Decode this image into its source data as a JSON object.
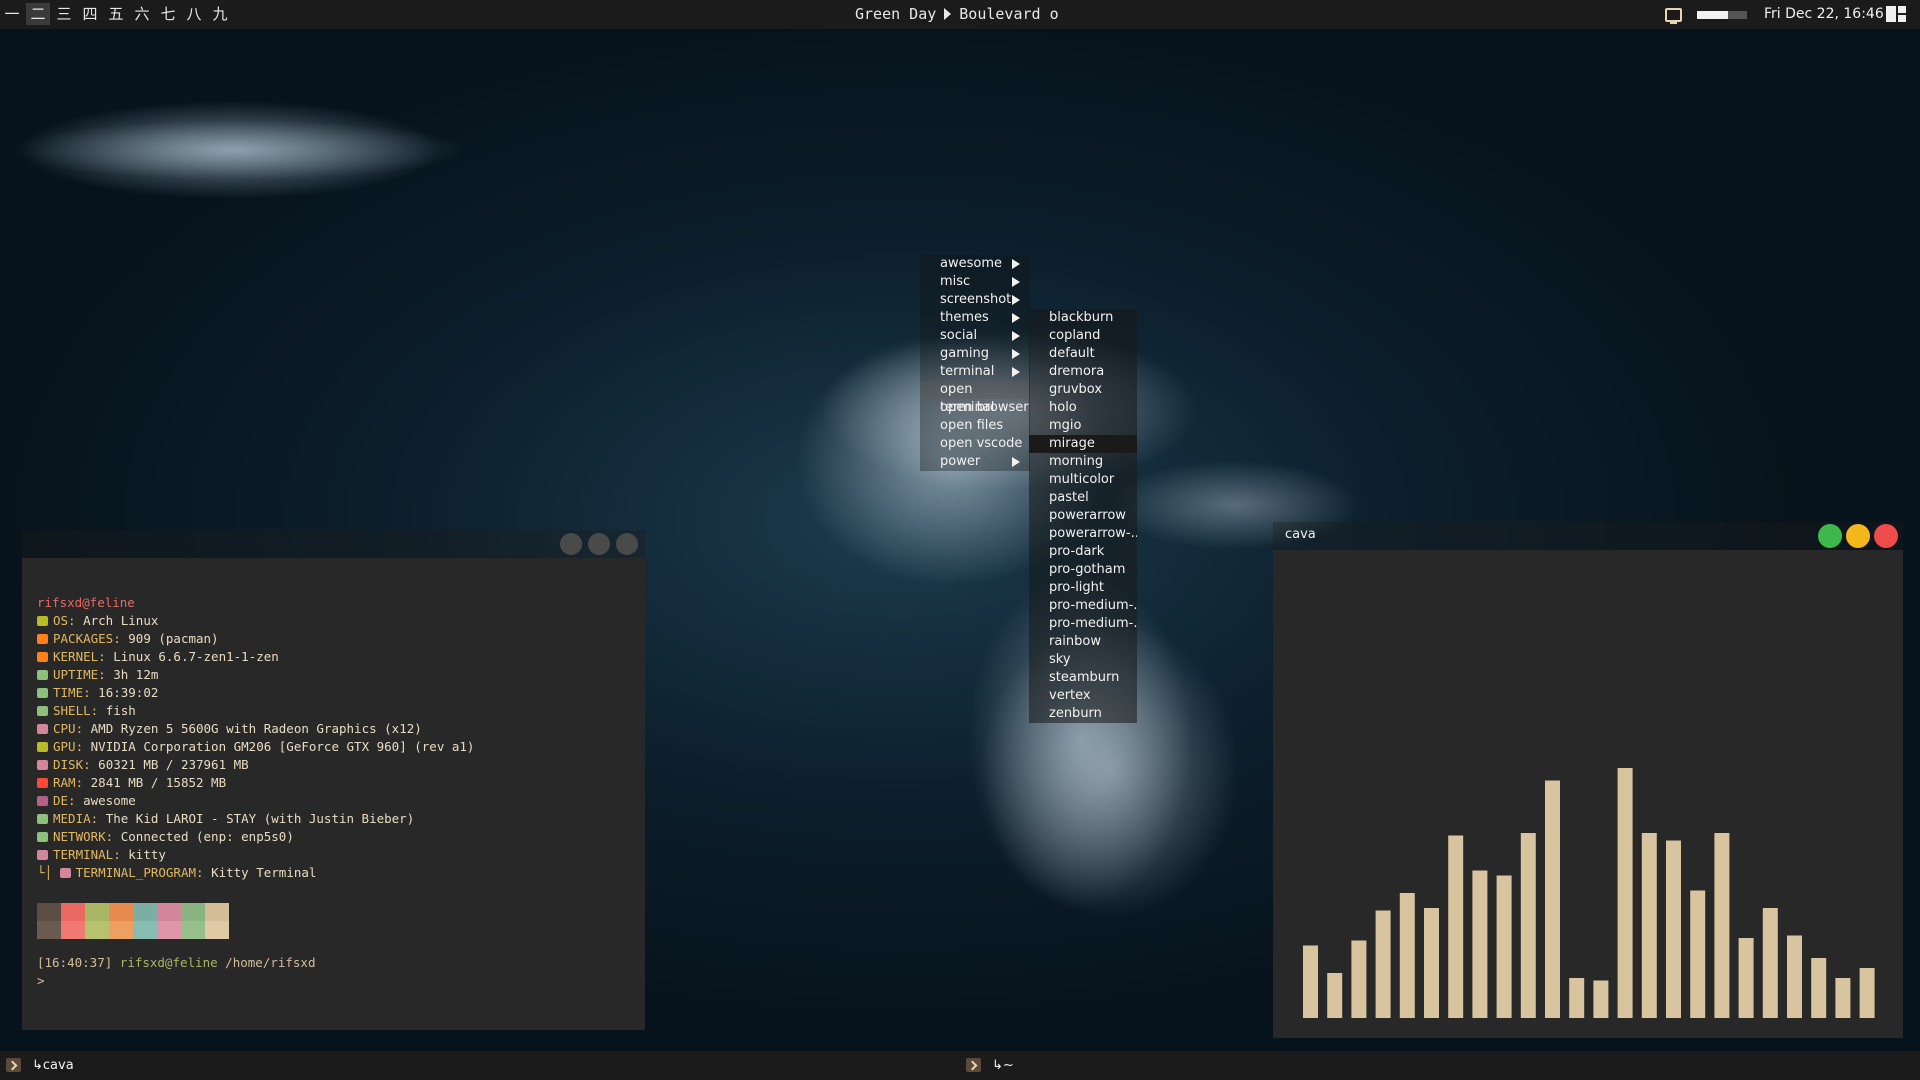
{
  "topbar": {
    "tags": [
      "一",
      "二",
      "三",
      "四",
      "五",
      "六",
      "七",
      "八",
      "九"
    ],
    "active_tag_index": 1,
    "now_playing": {
      "artist": "Green Day",
      "title": "Boulevard o"
    },
    "battery_level": 0.62,
    "clock": "Fri Dec 22, 16:46"
  },
  "menu": {
    "items": [
      {
        "label": "awesome",
        "submenu": true
      },
      {
        "label": "misc",
        "submenu": true
      },
      {
        "label": "screenshot",
        "submenu": true
      },
      {
        "label": "themes",
        "submenu": true
      },
      {
        "label": "social",
        "submenu": true
      },
      {
        "label": "gaming",
        "submenu": true
      },
      {
        "label": "terminal",
        "submenu": true
      },
      {
        "label": "open terminal",
        "submenu": false
      },
      {
        "label": "open browser",
        "submenu": false
      },
      {
        "label": "open files",
        "submenu": false
      },
      {
        "label": "open vscode",
        "submenu": false
      },
      {
        "label": "power",
        "submenu": true
      }
    ],
    "selected_index": 7,
    "themes": [
      "blackburn",
      "copland",
      "default",
      "dremora",
      "gruvbox",
      "holo",
      "mgio",
      "mirage",
      "morning",
      "multicolor",
      "pastel",
      "powerarrow",
      "powerarrow-...",
      "pro-dark",
      "pro-gotham",
      "pro-light",
      "pro-medium-...",
      "pro-medium-...",
      "rainbow",
      "sky",
      "steamburn",
      "vertex",
      "zenburn"
    ],
    "selected_theme_index": 7
  },
  "kitty": {
    "user_host": "rifsxd@feline",
    "info": [
      {
        "icon": "monitor-icon",
        "label": "OS:",
        "value": "Arch Linux",
        "color": "#b8bb26"
      },
      {
        "icon": "package-icon",
        "label": "PACKAGES:",
        "value": "909 (pacman)",
        "color": "#fe8019"
      },
      {
        "icon": "tux-icon",
        "label": "KERNEL:",
        "value": "Linux 6.6.7-zen1-1-zen",
        "color": "#fe8019"
      },
      {
        "icon": "uptime-icon",
        "label": "UPTIME:",
        "value": "3h 12m",
        "color": "#8ec07c"
      },
      {
        "icon": "clock-icon",
        "label": "TIME:",
        "value": "16:39:02",
        "color": "#8ec07c"
      },
      {
        "icon": "shell-icon",
        "label": "SHELL:",
        "value": "fish",
        "color": "#8ec07c"
      },
      {
        "icon": "cpu-icon",
        "label": "CPU:",
        "value": "AMD Ryzen 5 5600G with Radeon Graphics (x12)",
        "color": "#d3869b"
      },
      {
        "icon": "gpu-icon",
        "label": "GPU:",
        "value": "NVIDIA Corporation GM206 [GeForce GTX 960] (rev a1)",
        "color": "#b8bb26"
      },
      {
        "icon": "disk-icon",
        "label": "DISK:",
        "value": "60321 MB / 237961 MB",
        "color": "#d3869b"
      },
      {
        "icon": "ram-icon",
        "label": "RAM:",
        "value": "2841 MB / 15852 MB",
        "color": "#fb4934"
      },
      {
        "icon": "de-icon",
        "label": "DE:",
        "value": "awesome",
        "color": "#b16286"
      },
      {
        "icon": "media-icon",
        "label": "MEDIA:",
        "value": "The Kid LAROI - STAY (with Justin Bieber)",
        "color": "#8ec07c"
      },
      {
        "icon": "network-icon",
        "label": "NETWORK:",
        "value": "Connected (enp: enp5s0)",
        "color": "#8ec07c"
      },
      {
        "icon": "terminal-icon",
        "label": "TERMINAL:",
        "value": "kitty",
        "color": "#d3869b"
      }
    ],
    "terminal_program": {
      "prefix": "└│",
      "label": "TERMINAL_PROGRAM:",
      "value": "Kitty Terminal"
    },
    "palette": [
      [
        "#5d4e45",
        "#ea6962",
        "#a9b665",
        "#e78a4e",
        "#7daea3",
        "#d3869b",
        "#89b482",
        "#d4be98"
      ],
      [
        "#6a5a50",
        "#f07a72",
        "#b7c270",
        "#eda060",
        "#89bdb2",
        "#df95a8",
        "#95c08e",
        "#e0caa5"
      ]
    ],
    "prompt": {
      "time": "[16:40:37]",
      "user": "rifsxd@feline",
      "path": "/home/rifsxd",
      "symbol": ">"
    }
  },
  "cava": {
    "title": "cava",
    "bar_color": "#d8c49e",
    "levels": [
      0.29,
      0.18,
      0.31,
      0.43,
      0.5,
      0.44,
      0.73,
      0.59,
      0.57,
      0.74,
      0.95,
      0.16,
      0.15,
      1.0,
      0.74,
      0.71,
      0.51,
      0.74,
      0.32,
      0.44,
      0.33,
      0.24,
      0.16,
      0.2
    ]
  },
  "bottombar": {
    "tasks": [
      {
        "label": "cava"
      },
      {
        "label": "~"
      }
    ]
  }
}
